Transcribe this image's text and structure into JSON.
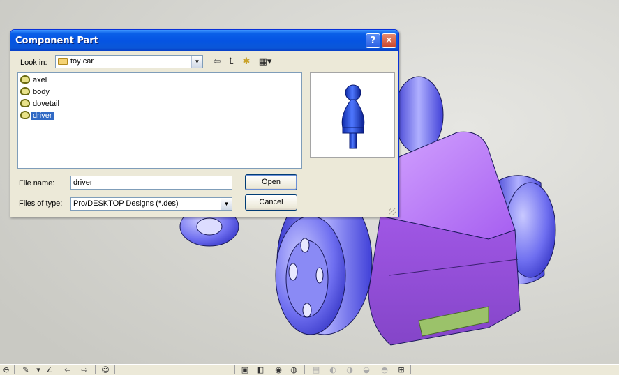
{
  "dialog": {
    "title": "Component Part",
    "help_glyph": "?",
    "close_glyph": "✕"
  },
  "look_in": {
    "label": "Look in:",
    "value": "toy car",
    "icon": "folder-icon"
  },
  "nav_tools": [
    "back-arrow-icon",
    "up-folder-icon",
    "new-folder-icon",
    "view-menu-icon"
  ],
  "files": [
    {
      "name": "axel",
      "selected": false
    },
    {
      "name": "body",
      "selected": false
    },
    {
      "name": "dovetail",
      "selected": false
    },
    {
      "name": "driver",
      "selected": true
    }
  ],
  "file_name": {
    "label": "File name:",
    "value": "driver"
  },
  "file_type": {
    "label": "Files of type:",
    "value": "Pro/DESKTOP Designs (*.des)"
  },
  "buttons": {
    "open": "Open",
    "cancel": "Cancel"
  },
  "colors": {
    "model_purple": "#a256e8",
    "wheel_blue": "#5f5fe8",
    "preview_blue": "#1c3fd9",
    "titlebar_blue": "#0554e3",
    "selection_blue": "#316ac5"
  }
}
